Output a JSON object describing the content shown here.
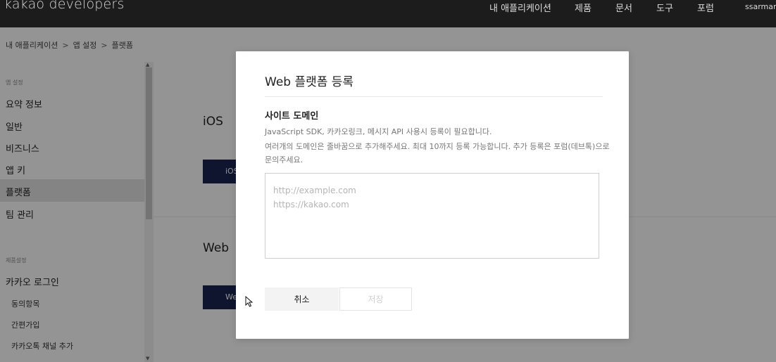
{
  "topbar": {
    "logo": "kakao developers",
    "nav": [
      "내 애플리케이션",
      "제품",
      "문서",
      "도구",
      "포럼"
    ],
    "user": "ssarmang"
  },
  "breadcrumb": [
    "내 애플리케이션",
    "앱 설정",
    "플랫폼"
  ],
  "sidebar": {
    "section1": "앱 설정",
    "items": [
      "요약 정보",
      "일반",
      "비즈니스",
      "앱 키",
      "플랫폼",
      "팀 관리"
    ],
    "active": "플랫폼",
    "section2": "제품설정",
    "product_item": "카카오 로그인",
    "sub_items": [
      "동의항목",
      "간편가입",
      "카카오톡 채널 추가"
    ]
  },
  "main": {
    "ios_title": "iOS",
    "ios_button": "iOS 플랫폼 등록",
    "web_title": "Web",
    "web_button": "Web 플랫폼 등록"
  },
  "modal": {
    "title": "Web 플랫폼 등록",
    "field_label": "사이트 도메인",
    "help_line1": "JavaScript SDK, 카카오링크, 메시지 API 사용시 등록이 필요합니다.",
    "help_line2": "여러개의 도메인은 줄바꿈으로 추가해주세요. 최대 10까지 등록 가능합니다. 추가 등록은 포럼(데브톡)으로 문의주세요.",
    "placeholder": "http://example.com\nhttps://kakao.com",
    "cancel_label": "취소",
    "save_label": "저장"
  }
}
